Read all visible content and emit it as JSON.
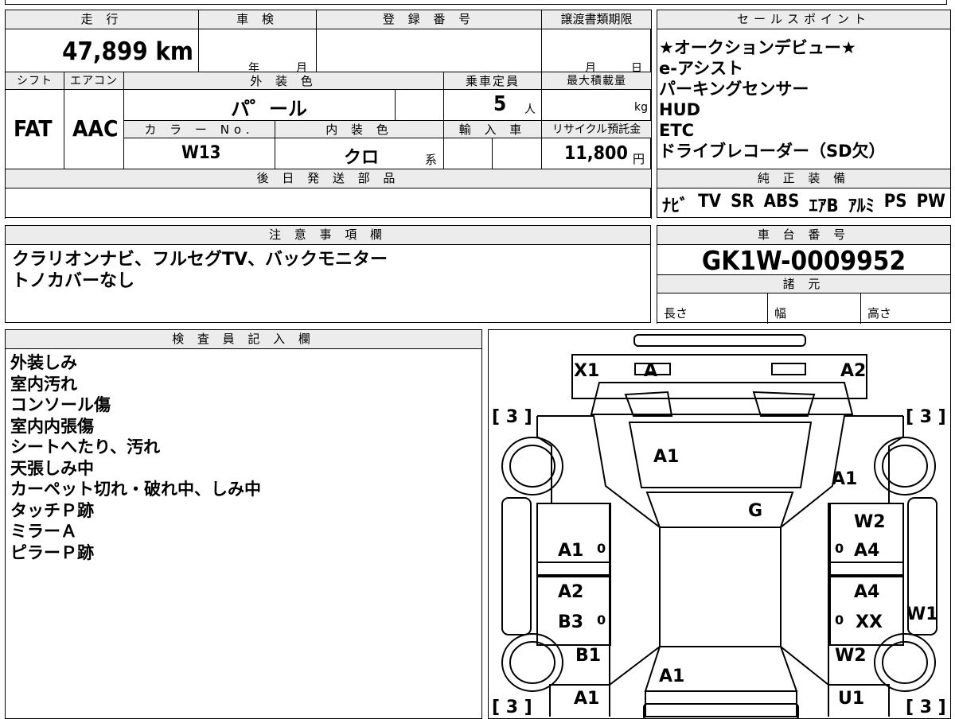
{
  "vehicle": {
    "mileage_label": "走 行",
    "mileage": "47,899 km",
    "inspection_label": "車 検",
    "inspection_year": "年",
    "inspection_month": "月",
    "registration_label": "登 録 番 号",
    "transfer_label": "譲渡書類期限",
    "transfer_month": "月",
    "transfer_day": "日",
    "shift_label": "シフト",
    "shift": "FAT",
    "ac_label": "エアコン",
    "ac": "AAC",
    "exterior_color_label": "外 装 色",
    "exterior_color": "パ゜ール",
    "capacity_label": "乗車定員",
    "capacity": "5",
    "capacity_unit": "人",
    "max_load_label": "最大積載量",
    "max_load_unit": "kg",
    "color_no_label": "カ ラ ー No.",
    "color_no": "W13",
    "interior_color_label": "内 装 色",
    "interior_color": "クロ",
    "interior_suffix": "系",
    "import_label": "輸 入 車",
    "recycle_label": "リサイクル預託金",
    "recycle_fee": "11,800",
    "recycle_unit": "円",
    "later_parts_label": "後 日 発 送 部 品"
  },
  "sales_points": {
    "title": "セールスポイント",
    "items": [
      "★オークションデビュー★",
      "e-アシスト",
      "パーキングセンサー",
      "HUD",
      "ETC",
      "ドライブレコーダー（SD欠）"
    ]
  },
  "equipment": {
    "title": "純 正 装 備",
    "items": [
      "ﾅﾋﾞ",
      "TV",
      "SR",
      "ABS",
      "ｴｱB",
      "ｱﾙﾐ",
      "PS",
      "PW"
    ]
  },
  "notes": {
    "title": "注 意 事 項 欄",
    "lines": [
      "クラリオンナビ、フルセグTV、バックモニター",
      "トノカバーなし"
    ]
  },
  "chassis": {
    "title": "車 台 番 号",
    "number": "GK1W-0009952",
    "specs_title": "諸 元",
    "length_label": "長さ",
    "width_label": "幅",
    "height_label": "高さ"
  },
  "inspector": {
    "title": "検 査 員 記 入 欄",
    "lines": [
      "外装しみ",
      "室内汚れ",
      "コンソール傷",
      "室内内張傷",
      "シートへたり、汚れ",
      "天張しみ中",
      "カーペット切れ・破れ中、しみ中",
      "タッチＰ跡",
      "ミラーＡ",
      "ピラーＰ跡"
    ]
  },
  "diagram": {
    "marks": {
      "x1": "X1",
      "a_front": "A",
      "a2_front": "A2",
      "hood": "A1",
      "right_fender": "A1",
      "windshield": "G",
      "front_left_door": "A1",
      "front_left_door_zero": "0",
      "front_right_door_top": "W2",
      "front_right_door_zero": "0",
      "front_right_door": "A4",
      "rear_left_door_a2": "A2",
      "rear_left_door_b3": "B3",
      "rear_left_door_zero": "0",
      "rear_right_door_a4": "A4",
      "rear_right_door_zero": "0",
      "rear_right_door_xx": "XX",
      "right_side_w1": "W1",
      "left_quarter_b1": "B1",
      "rear_a1": "A1",
      "right_quarter_w2": "W2",
      "left_rear_a1": "A1",
      "right_rear_u1": "U1"
    },
    "tire_labels": {
      "front_left": "[ 3 ]",
      "front_right": "[ 3 ]",
      "rear_left": "[ 3 ]",
      "rear_right": "[ 3 ]"
    }
  }
}
